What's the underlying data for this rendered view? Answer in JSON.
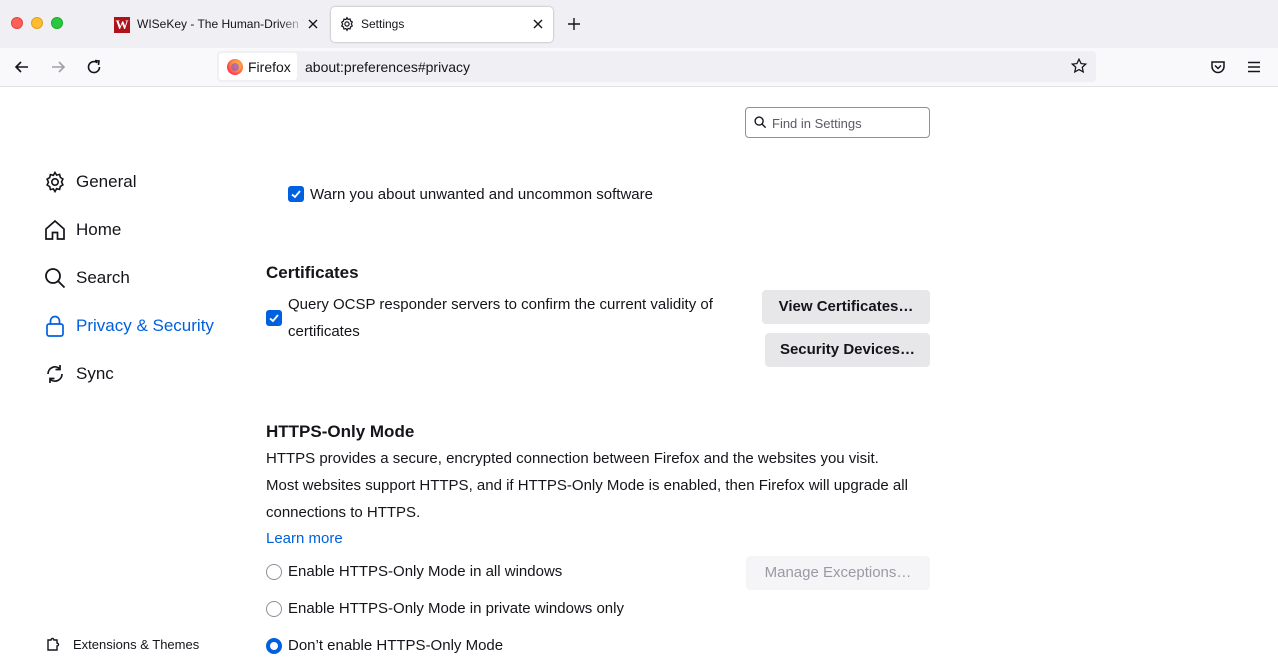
{
  "tabs": [
    {
      "title": "WISeKey - The Human-Driven Trust",
      "favicon": "W"
    },
    {
      "title": "Settings",
      "icon": "gear-icon"
    }
  ],
  "navbar": {
    "identity_label": "Firefox",
    "url": "about:preferences#privacy"
  },
  "search": {
    "placeholder": "Find in Settings"
  },
  "sidebar": {
    "items": [
      {
        "label": "General",
        "icon": "gear-icon"
      },
      {
        "label": "Home",
        "icon": "home-icon"
      },
      {
        "label": "Search",
        "icon": "search-icon"
      },
      {
        "label": "Privacy & Security",
        "icon": "lock-icon",
        "active": true
      },
      {
        "label": "Sync",
        "icon": "sync-icon"
      }
    ],
    "extensions_label": "Extensions & Themes"
  },
  "main": {
    "warn_unwanted": {
      "label": "Warn you about unwanted and uncommon software",
      "checked": true
    },
    "certificates": {
      "heading": "Certificates",
      "ocsp_line1": "Query OCSP responder servers to confirm the current validity of",
      "ocsp_line2": "certificates",
      "ocsp_checked": true,
      "view_button": "View Certificates…",
      "devices_button": "Security Devices…"
    },
    "https_only": {
      "heading": "HTTPS-Only Mode",
      "desc_line1": "HTTPS provides a secure, encrypted connection between Firefox and the websites you visit.",
      "desc_line2": "Most websites support HTTPS, and if HTTPS-Only Mode is enabled, then Firefox will upgrade all",
      "desc_line3": "connections to HTTPS.",
      "learn_more": "Learn more",
      "manage_exceptions": "Manage Exceptions…",
      "options": [
        {
          "label": "Enable HTTPS-Only Mode in all windows",
          "selected": false
        },
        {
          "label": "Enable HTTPS-Only Mode in private windows only",
          "selected": false
        },
        {
          "label": "Don’t enable HTTPS-Only Mode",
          "selected": true
        }
      ]
    }
  },
  "colors": {
    "accent": "#0061e0",
    "tabstrip": "#f0f0f4"
  }
}
